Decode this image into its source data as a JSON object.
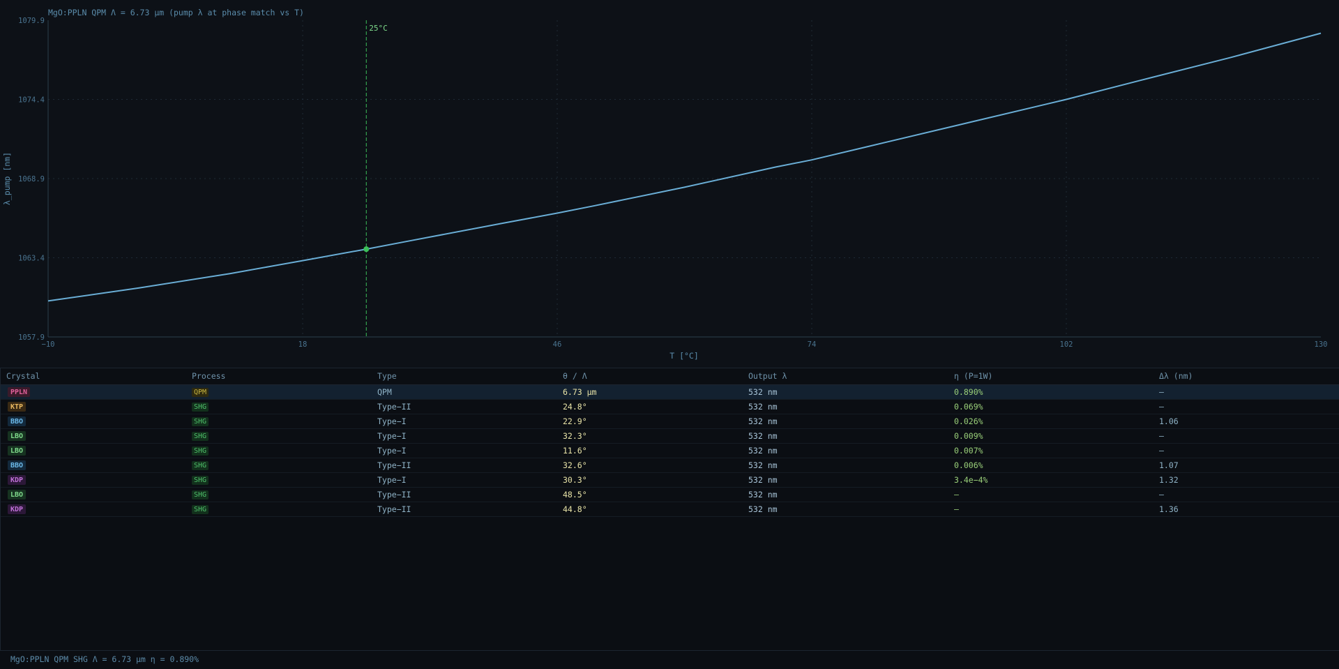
{
  "chart_data": {
    "type": "line",
    "title": "MgO:PPLN QPM   Λ = 6.73 µm   (pump λ at phase match vs T)",
    "xlabel": "T  [°C]",
    "ylabel": "λ_pump [nm]",
    "xlim": [
      -10,
      130
    ],
    "ylim": [
      1057.9,
      1079.9
    ],
    "x_ticks": [
      "−10",
      "18",
      "46",
      "74",
      "102",
      "130"
    ],
    "y_ticks": [
      "1057.9",
      "1063.4",
      "1068.9",
      "1074.4",
      "1079.9"
    ],
    "grid": true,
    "line_color": "#6aaed6",
    "marker": {
      "label": "25°C",
      "x": 25,
      "y": 1064.0,
      "color": "#3cc05a"
    },
    "series": [
      {
        "x": [
          -10,
          0,
          10,
          18,
          25,
          30,
          40,
          46,
          50,
          60,
          70,
          74,
          80,
          90,
          100,
          102,
          110,
          120,
          130
        ],
        "values": [
          1060.4,
          1061.3,
          1062.3,
          1063.2,
          1064.0,
          1064.6,
          1065.8,
          1066.5,
          1067.0,
          1068.3,
          1069.7,
          1070.2,
          1071.1,
          1072.6,
          1074.1,
          1074.4,
          1075.7,
          1077.3,
          1079.0
        ]
      }
    ]
  },
  "table": {
    "headers": [
      "Crystal",
      "Process",
      "Type",
      "θ / Λ",
      "Output λ",
      "η (P=1W)",
      "Δλ (nm)"
    ],
    "rows": [
      {
        "crystal": "PPLN",
        "crystal_color": "#e0609a",
        "crystal_bg": "#3a1a2a",
        "process": "QPM",
        "process_color": "#c8b640",
        "process_bg": "#2e2a10",
        "type": "QPM",
        "angle": "6.73 µm",
        "output": "532 nm",
        "eff": "0.890%",
        "bw": "—",
        "selected": true
      },
      {
        "crystal": "KTP",
        "crystal_color": "#e8b860",
        "crystal_bg": "#3a2a14",
        "process": "SHG",
        "process_color": "#4fbf6a",
        "process_bg": "#12301c",
        "type": "Type−II",
        "angle": "24.8°",
        "output": "532 nm",
        "eff": "0.069%",
        "bw": "—",
        "selected": false
      },
      {
        "crystal": "BBO",
        "crystal_color": "#6ab8e8",
        "crystal_bg": "#13293c",
        "process": "SHG",
        "process_color": "#4fbf6a",
        "process_bg": "#12301c",
        "type": "Type−I",
        "angle": "22.9°",
        "output": "532 nm",
        "eff": "0.026%",
        "bw": "1.06",
        "selected": false
      },
      {
        "crystal": "LBO",
        "crystal_color": "#7ed88a",
        "crystal_bg": "#163220",
        "process": "SHG",
        "process_color": "#4fbf6a",
        "process_bg": "#12301c",
        "type": "Type−I",
        "angle": "32.3°",
        "output": "532 nm",
        "eff": "0.009%",
        "bw": "—",
        "selected": false
      },
      {
        "crystal": "LBO",
        "crystal_color": "#7ed88a",
        "crystal_bg": "#163220",
        "process": "SHG",
        "process_color": "#4fbf6a",
        "process_bg": "#12301c",
        "type": "Type−I",
        "angle": "11.6°",
        "output": "532 nm",
        "eff": "0.007%",
        "bw": "—",
        "selected": false
      },
      {
        "crystal": "BBO",
        "crystal_color": "#6ab8e8",
        "crystal_bg": "#13293c",
        "process": "SHG",
        "process_color": "#4fbf6a",
        "process_bg": "#12301c",
        "type": "Type−II",
        "angle": "32.6°",
        "output": "532 nm",
        "eff": "0.006%",
        "bw": "1.07",
        "selected": false
      },
      {
        "crystal": "KDP",
        "crystal_color": "#c070d8",
        "crystal_bg": "#2c1838",
        "process": "SHG",
        "process_color": "#4fbf6a",
        "process_bg": "#12301c",
        "type": "Type−I",
        "angle": "30.3°",
        "output": "532 nm",
        "eff": "3.4e−4%",
        "bw": "1.32",
        "selected": false
      },
      {
        "crystal": "LBO",
        "crystal_color": "#7ed88a",
        "crystal_bg": "#163220",
        "process": "SHG",
        "process_color": "#4fbf6a",
        "process_bg": "#12301c",
        "type": "Type−II",
        "angle": "48.5°",
        "output": "532 nm",
        "eff": "—",
        "bw": "—",
        "selected": false
      },
      {
        "crystal": "KDP",
        "crystal_color": "#c070d8",
        "crystal_bg": "#2c1838",
        "process": "SHG",
        "process_color": "#4fbf6a",
        "process_bg": "#12301c",
        "type": "Type−II",
        "angle": "44.8°",
        "output": "532 nm",
        "eff": "—",
        "bw": "1.36",
        "selected": false
      }
    ]
  },
  "status_bar": {
    "text": "MgO:PPLN QPM SHG Λ = 6.73 µm η = 0.890%"
  }
}
